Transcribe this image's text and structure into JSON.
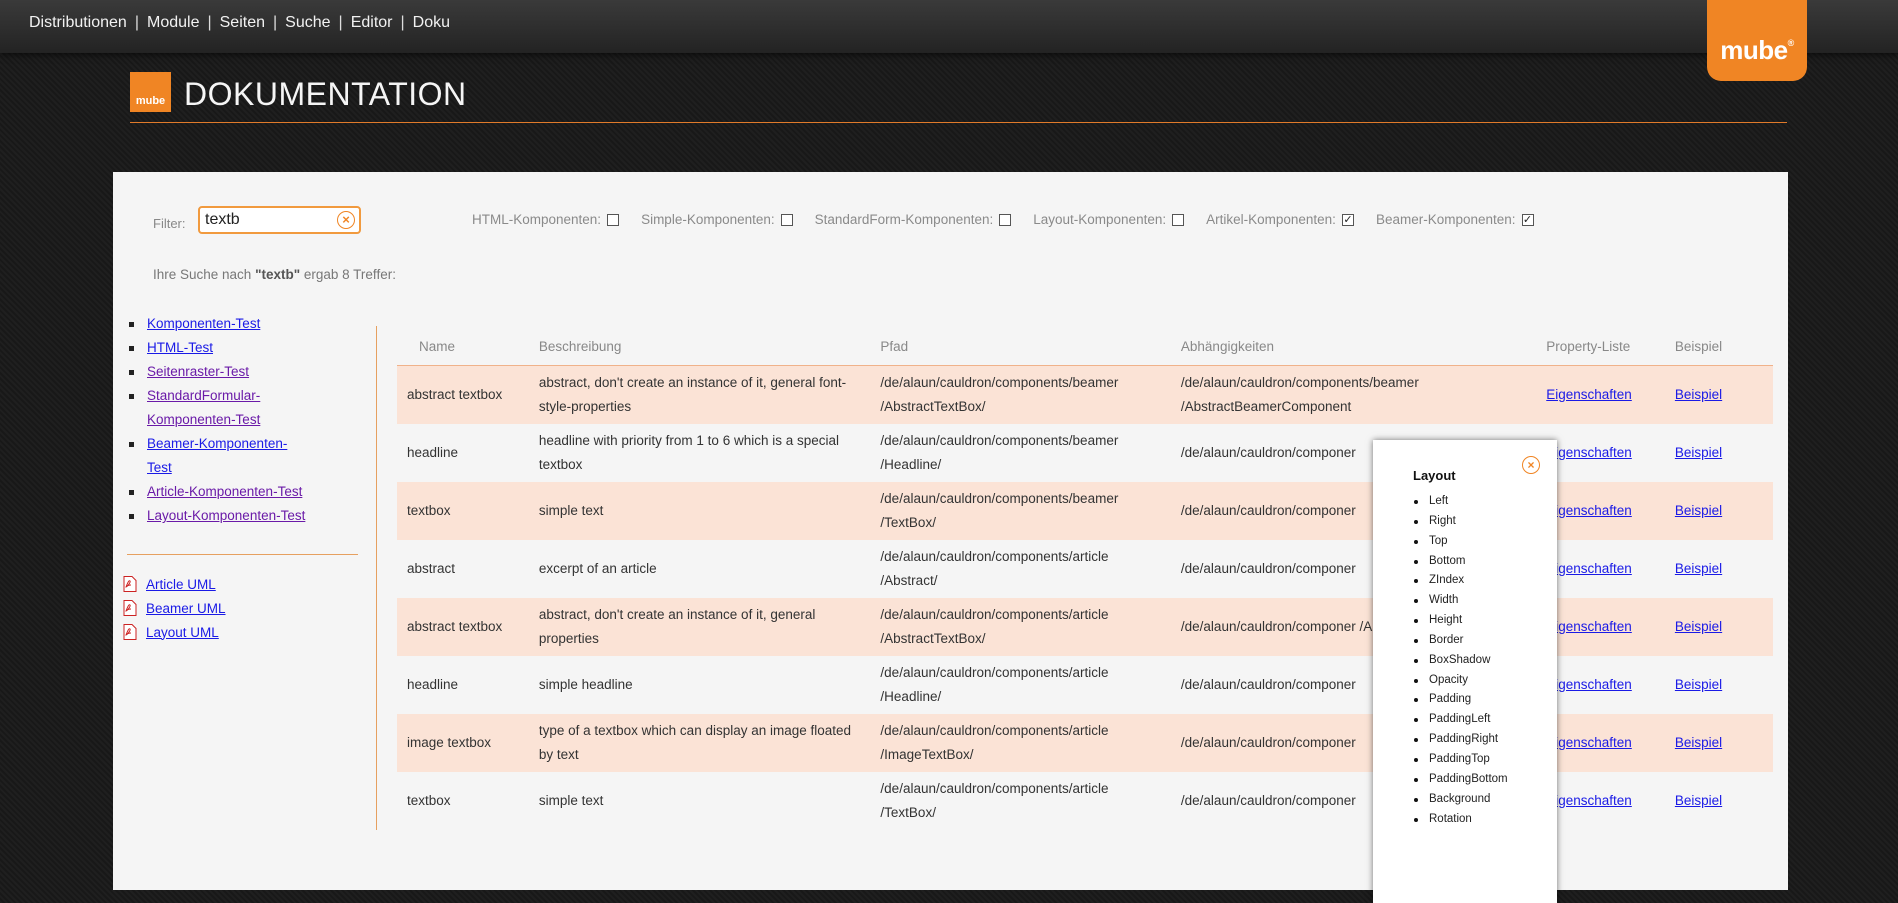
{
  "nav": {
    "items": [
      "Distributionen",
      "Module",
      "Seiten",
      "Suche",
      "Editor",
      "Doku"
    ],
    "separator": "|"
  },
  "brand": {
    "name": "mube",
    "mark": "®"
  },
  "header": {
    "logo_text": "mube",
    "title": "DOKUMENTATION"
  },
  "filter": {
    "label": "Filter:",
    "value": "textb",
    "clear_icon": "clear-circle-icon",
    "checkboxes": [
      {
        "label": "HTML-Komponenten:",
        "checked": false
      },
      {
        "label": "Simple-Komponenten:",
        "checked": false
      },
      {
        "label": "StandardForm-Komponenten:",
        "checked": false
      },
      {
        "label": "Layout-Komponenten:",
        "checked": false
      },
      {
        "label": "Artikel-Komponenten:",
        "checked": true
      },
      {
        "label": "Beamer-Komponenten:",
        "checked": true
      }
    ]
  },
  "result": {
    "prefix": "Ihre Suche nach ",
    "query": "\"textb\"",
    "suffix": " ergab 8 Treffer:"
  },
  "sidebar": {
    "links": [
      {
        "label": "Komponenten-Test",
        "visited": false
      },
      {
        "label": "HTML-Test",
        "visited": false
      },
      {
        "label": "Seitenraster-Test",
        "visited": true
      },
      {
        "label": "StandardFormular-Komponenten-Test",
        "visited": true
      },
      {
        "label": "Beamer-Komponenten-Test",
        "visited": false
      },
      {
        "label": "Article-Komponenten-Test",
        "visited": true
      },
      {
        "label": "Layout-Komponenten-Test",
        "visited": true
      }
    ],
    "pdfs": [
      {
        "label": "Article UML",
        "icon": "pdf-icon"
      },
      {
        "label": "Beamer UML",
        "icon": "pdf-icon"
      },
      {
        "label": "Layout UML",
        "icon": "pdf-icon"
      }
    ]
  },
  "table": {
    "headers": [
      "Name",
      "Beschreibung",
      "Pfad",
      "Abhängigkeiten",
      "Property-Liste",
      "Beispiel"
    ],
    "rows": [
      {
        "name": "abstract textbox",
        "desc": "abstract, don't create an instance of it, general font-style-properties",
        "path": "/de/alaun/cauldron/components/beamer /AbstractTextBox/",
        "deps": "/de/alaun/cauldron/components/beamer /AbstractBeamerComponent",
        "props": "Eigenschaften",
        "example": "Beispiel"
      },
      {
        "name": "headline",
        "desc": "headline with priority from 1 to 6 which is a special textbox",
        "path": "/de/alaun/cauldron/components/beamer /Headline/",
        "deps": "/de/alaun/cauldron/componer",
        "props": "Eigenschaften",
        "example": "Beispiel"
      },
      {
        "name": "textbox",
        "desc": "simple text",
        "path": "/de/alaun/cauldron/components/beamer /TextBox/",
        "deps": "/de/alaun/cauldron/componer",
        "props": "Eigenschaften",
        "example": "Beispiel"
      },
      {
        "name": "abstract",
        "desc": "excerpt of an article",
        "path": "/de/alaun/cauldron/components/article /Abstract/",
        "deps": "/de/alaun/cauldron/componer",
        "props": "Eigenschaften",
        "example": "Beispiel"
      },
      {
        "name": "abstract textbox",
        "desc": "abstract, don't create an instance of it, general properties",
        "path": "/de/alaun/cauldron/components/article /AbstractTextBox/",
        "deps": "/de/alaun/cauldron/componer /AbstractArticleComponent",
        "props": "Eigenschaften",
        "example": "Beispiel"
      },
      {
        "name": "headline",
        "desc": "simple headline",
        "path": "/de/alaun/cauldron/components/article /Headline/",
        "deps": "/de/alaun/cauldron/componer",
        "props": "Eigenschaften",
        "example": "Beispiel"
      },
      {
        "name": "image textbox",
        "desc": "type of a textbox which can display an image floated by text",
        "path": "/de/alaun/cauldron/components/article /ImageTextBox/",
        "deps": "/de/alaun/cauldron/componer",
        "props": "Eigenschaften",
        "example": "Beispiel"
      },
      {
        "name": "textbox",
        "desc": "simple text",
        "path": "/de/alaun/cauldron/components/article /TextBox/",
        "deps": "/de/alaun/cauldron/componer",
        "props": "Eigenschaften",
        "example": "Beispiel"
      }
    ]
  },
  "popup": {
    "title": "Layout",
    "close_icon": "close-circle-icon",
    "items": [
      "Left",
      "Right",
      "Top",
      "Bottom",
      "ZIndex",
      "Width",
      "Height",
      "Border",
      "BoxShadow",
      "Opacity",
      "Padding",
      "PaddingLeft",
      "PaddingRight",
      "PaddingTop",
      "PaddingBottom",
      "Background",
      "Rotation"
    ]
  },
  "colors": {
    "accent": "#f08524",
    "row_alt": "#fbe3d6",
    "link": "#1a1ae6",
    "visited": "#6a1aa8"
  }
}
